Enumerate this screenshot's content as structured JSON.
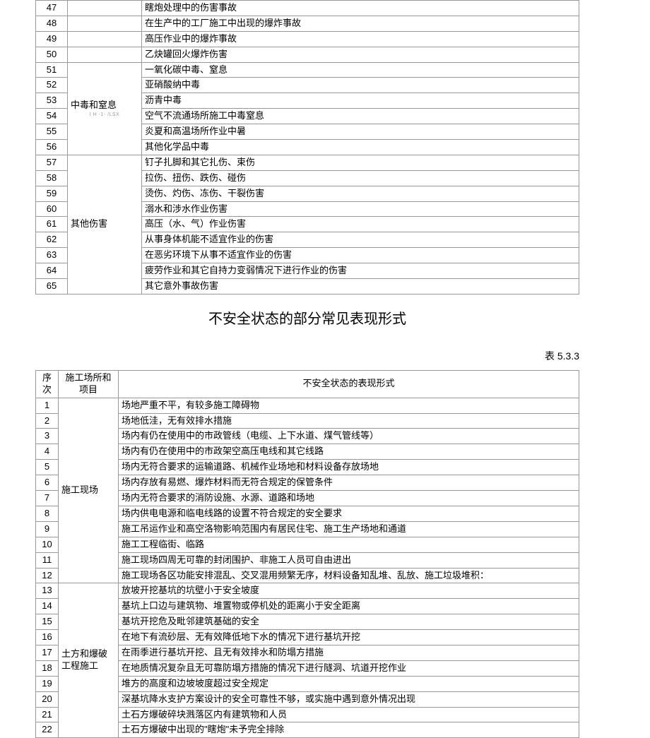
{
  "table1": {
    "rows_explosion": [
      {
        "n": "47",
        "desc": "瞎炮处理中的伤害事故"
      },
      {
        "n": "48",
        "desc": "在生产中的工厂施工中出现的爆炸事故"
      },
      {
        "n": "49",
        "desc": "高压作业中的爆炸事故"
      },
      {
        "n": "50",
        "desc": "乙炔罐回火爆炸伤害"
      }
    ],
    "cat_poison": "中毒和窒息",
    "tiny_note": "I     H -1- /LSX",
    "rows_poison": [
      {
        "n": "51",
        "desc": "一氧化碳中毒、窒息"
      },
      {
        "n": "52",
        "desc": "亚硝酸纳中毒"
      },
      {
        "n": "53",
        "desc": "沥青中毒"
      },
      {
        "n": "54",
        "desc": "空气不流通场所施工中毒窒息"
      },
      {
        "n": "55",
        "desc": "炎夏和高温场所作业中暑"
      },
      {
        "n": "56",
        "desc": "其他化学品中毒"
      }
    ],
    "cat_other": "其他伤害",
    "rows_other": [
      {
        "n": "57",
        "desc": "钉子扎脚和其它扎伤、束伤"
      },
      {
        "n": "58",
        "desc": "拉伤、扭伤、跌伤、碰伤"
      },
      {
        "n": "59",
        "desc": "烫伤、灼伤、冻伤、干裂伤害"
      },
      {
        "n": "60",
        "desc": "溺水和涉水作业伤害"
      },
      {
        "n": "61",
        "desc": "高压（水、气）作业伤害"
      },
      {
        "n": "62",
        "desc": "从事身体机能不适宜作业的伤害"
      },
      {
        "n": "63",
        "desc": "在恶劣环境下从事不适宜作业的伤害"
      },
      {
        "n": "64",
        "desc": "疲劳作业和其它自持力变弱情况下进行作业的伤害"
      },
      {
        "n": "65",
        "desc": "其它意外事故伤害"
      }
    ]
  },
  "section_title": "不安全状态的部分常见表现形式",
  "table_label": "表 5.3.3",
  "table2": {
    "header": {
      "c1": "序 次",
      "c2": "施工场所和项目",
      "c3": "不安全状态的表现形式"
    },
    "cat_site": "施工现场",
    "rows_site": [
      {
        "n": "1",
        "desc": "场地严重不平，有较多施工障碍物"
      },
      {
        "n": "2",
        "desc": "场地低洼，无有效排水措施"
      },
      {
        "n": "3",
        "desc": "场内有仍在使用中的市政管线（电缆、上下水道、煤气管线等）"
      },
      {
        "n": "4",
        "desc": "场内有仍在使用中的市政架空高压电线和其它线路"
      },
      {
        "n": "5",
        "desc": "场内无符合要求的运输道路、机械作业场地和材料设备存放场地"
      },
      {
        "n": "6",
        "desc": "场内存放有易燃、爆炸材料而无符合规定的保管条件"
      },
      {
        "n": "7",
        "desc": "场内无符合要求的消防设施、水源、道路和场地"
      },
      {
        "n": "8",
        "desc": "场内供电电源和临电线路的设置不符合规定的安全要求"
      },
      {
        "n": "9",
        "desc": "施工吊运作业和高空洛物影响范围内有居民住宅、施工生产场地和通道"
      },
      {
        "n": "10",
        "desc": "施工工程临街、临路"
      },
      {
        "n": "11",
        "desc": "施工现场四周无可靠的封闭围护、非施工人员可自由进出"
      },
      {
        "n": "12",
        "desc": "施工现场各区功能安排混乱、交叉混用频繁无序，材料设备知乱堆、乱放、施工垃圾堆积："
      }
    ],
    "cat_earth": "土方和爆破工程施工",
    "rows_earth": [
      {
        "n": "13",
        "desc": "放坡开挖基坑的坑壁小于安全坡度"
      },
      {
        "n": "14",
        "desc": "基坑上口边与建筑物、堆置物或停机处的距离小于安全距离"
      },
      {
        "n": "15",
        "desc": "基坑开挖危及毗邻建筑基础的安全"
      },
      {
        "n": "16",
        "desc": "在地下有流砂层、无有效降低地下水的情况下进行基坑开挖"
      },
      {
        "n": "17",
        "desc": "在雨季进行基坑开挖、且无有效排水和防塌方措施"
      },
      {
        "n": "18",
        "desc": "在地质情况复杂且无可靠防塌方措施的情况下进行隧洞、坑道开挖作业"
      },
      {
        "n": "19",
        "desc": "堆方的高度和边坡坡度超过安全规定"
      },
      {
        "n": "20",
        "desc": "深基坑降水支护方案设计的安全可靠性不够，或实施中遇到意外情况出现"
      },
      {
        "n": "21",
        "desc": "土石方爆破碎块溅落区内有建筑物和人员"
      },
      {
        "n": "22",
        "desc": "土石方爆破中出现的\"瞎炮\"未予完全排除"
      }
    ]
  }
}
